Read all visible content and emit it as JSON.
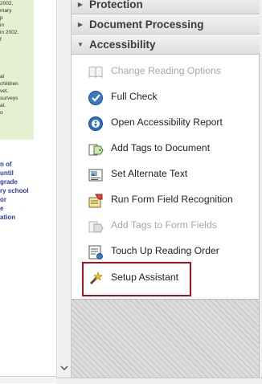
{
  "doc": {
    "green_lines": [
      "2002,",
      "mary",
      "p",
      "in",
      "in 2002.",
      "f",
      "",
      "",
      "",
      "",
      "al",
      "children",
      "vet,",
      "surveys",
      "al.",
      "o"
    ],
    "blue_lines": [
      "n of",
      "until",
      "grade",
      "ry school",
      "or",
      "e",
      "ation"
    ]
  },
  "panel": {
    "sections": [
      {
        "label": "Protection",
        "state": "collapsed"
      },
      {
        "label": "Document Processing",
        "state": "collapsed"
      },
      {
        "label": "Accessibility",
        "state": "expanded"
      }
    ],
    "items": [
      {
        "label": "Change Reading Options",
        "enabled": false,
        "icon": "book-icon"
      },
      {
        "label": "Full Check",
        "enabled": true,
        "icon": "check-shield-icon"
      },
      {
        "label": "Open Accessibility Report",
        "enabled": true,
        "icon": "accessibility-report-icon"
      },
      {
        "label": "Add Tags to Document",
        "enabled": true,
        "icon": "tag-icon"
      },
      {
        "label": "Set Alternate Text",
        "enabled": true,
        "icon": "image-text-icon"
      },
      {
        "label": "Run Form Field Recognition",
        "enabled": true,
        "icon": "form-field-icon"
      },
      {
        "label": "Add Tags to Form Fields",
        "enabled": false,
        "icon": "form-tag-icon"
      },
      {
        "label": "Touch Up Reading Order",
        "enabled": true,
        "icon": "reading-order-icon"
      },
      {
        "label": "Setup Assistant",
        "enabled": true,
        "icon": "wand-icon",
        "highlighted": true
      }
    ]
  },
  "colors": {
    "highlight_border": "#a4121e",
    "doc_green": "#e4f0cf",
    "doc_link_blue": "#2b3aa6"
  }
}
